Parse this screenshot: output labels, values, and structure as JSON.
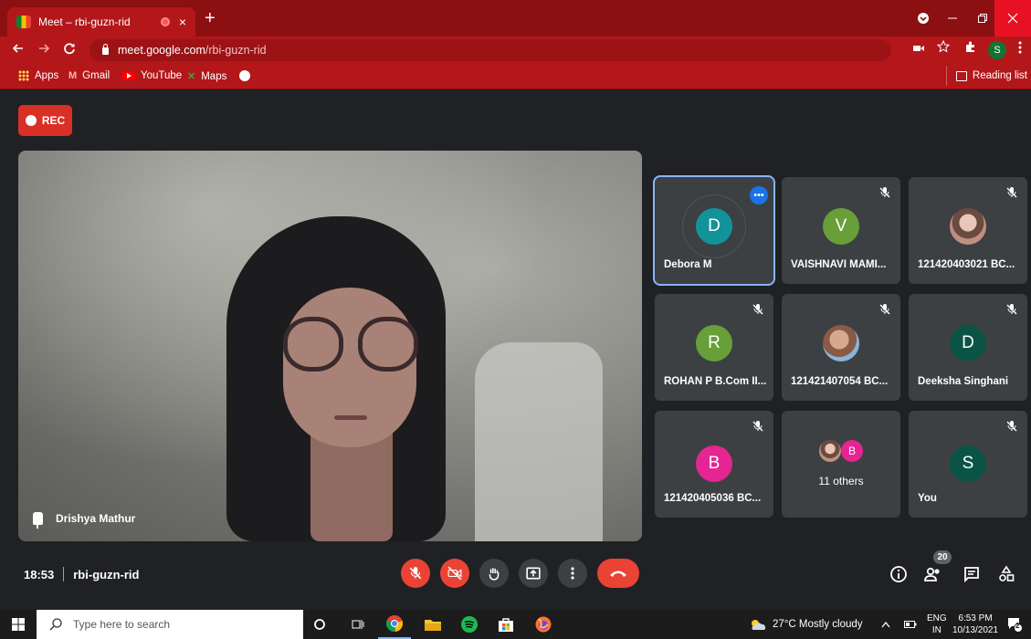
{
  "browser": {
    "tab_title": "Meet – rbi-guzn-rid",
    "tab_close": "×",
    "new_tab": "+",
    "url_host": "meet.google.com",
    "url_path": "/rbi-guzn-rid",
    "profile_initial": "S",
    "bookmarks": [
      {
        "label": "Apps",
        "icon": "apps-grid-icon"
      },
      {
        "label": "Gmail",
        "icon": "gmail-icon"
      },
      {
        "label": "YouTube",
        "icon": "youtube-icon"
      },
      {
        "label": "Maps",
        "icon": "maps-icon"
      }
    ],
    "reading_list": "Reading list",
    "theme_color": "#b3171a"
  },
  "meet": {
    "rec_label": "REC",
    "main_speaker": "Drishya Mathur",
    "meeting_time": "18:53",
    "meeting_code": "rbi-guzn-rid",
    "participant_count": "20",
    "tiles": [
      {
        "name": "Debora M",
        "initial": "D",
        "color": "#12939a",
        "muted": false,
        "speaking": true
      },
      {
        "name": "VAISHNAVI MAMI...",
        "initial": "V",
        "color": "#689f38",
        "muted": true
      },
      {
        "name": "121420403021 BC...",
        "initial": "",
        "color": "",
        "muted": true
      },
      {
        "name": "ROHAN P B.Com II...",
        "initial": "R",
        "color": "#689f38",
        "muted": true
      },
      {
        "name": "121421407054 BC...",
        "initial": "",
        "color": "",
        "muted": true
      },
      {
        "name": "Deeksha Singhani",
        "initial": "D",
        "color": "#0b5345",
        "muted": true
      },
      {
        "name": "121420405036 BC...",
        "initial": "B",
        "color": "#e52592",
        "muted": true
      },
      {
        "name": "11 others",
        "initial": "B",
        "color": "#e52592",
        "muted": false
      },
      {
        "name": "You",
        "initial": "S",
        "color": "#0b5345",
        "muted": true
      }
    ]
  },
  "taskbar": {
    "search_placeholder": "Type here to search",
    "weather": "27°C  Mostly cloudy",
    "lang_top": "ENG",
    "lang_bottom": "IN",
    "time": "6:53 PM",
    "date": "10/13/2021",
    "notifications": "2"
  }
}
